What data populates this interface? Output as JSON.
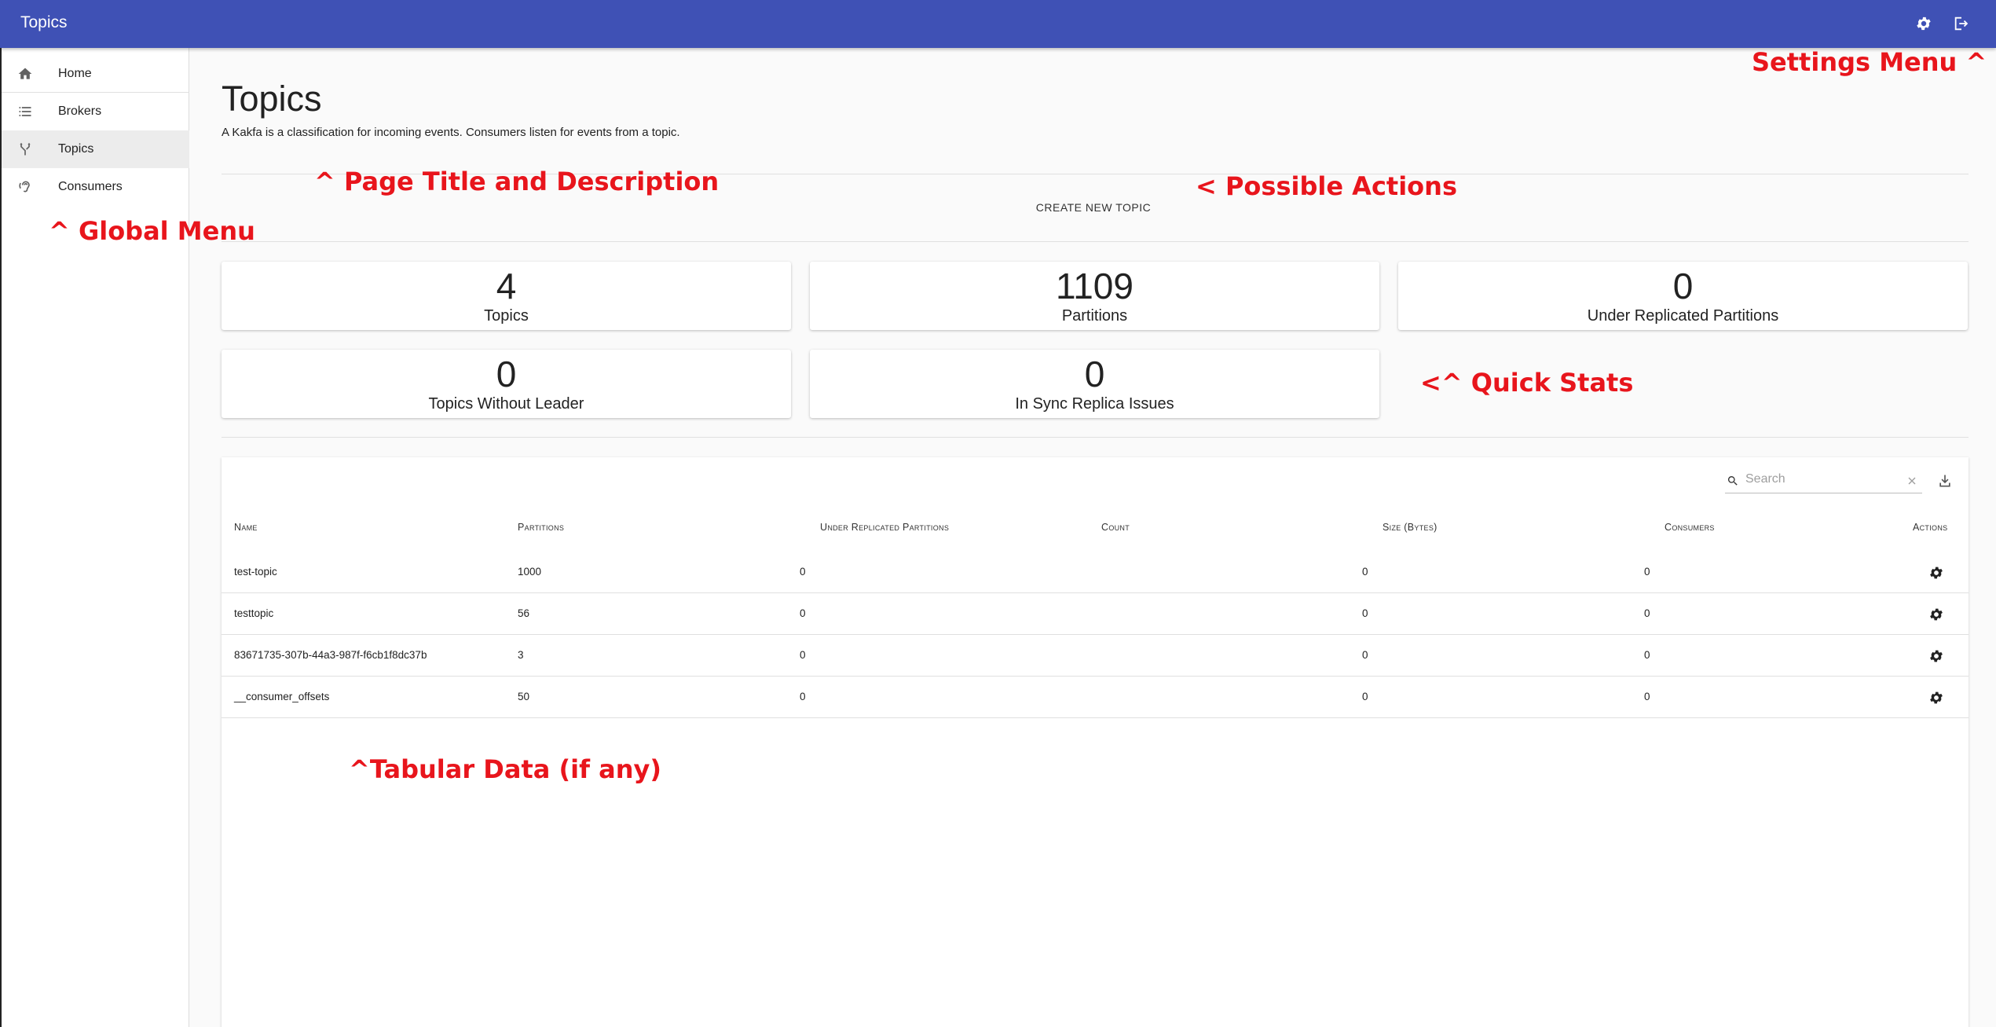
{
  "appbar": {
    "title": "Topics",
    "settings_icon": "gear-icon",
    "signout_icon": "exit-icon"
  },
  "sidebar": {
    "items": [
      {
        "label": "Home",
        "icon": "home-icon"
      },
      {
        "label": "Brokers",
        "icon": "list-icon"
      },
      {
        "label": "Topics",
        "icon": "fork-icon",
        "active": true
      },
      {
        "label": "Consumers",
        "icon": "ear-icon"
      }
    ]
  },
  "page": {
    "title": "Topics",
    "description": "A Kakfa is a classification for incoming events. Consumers listen for events from a topic.",
    "action_label": "CREATE NEW TOPIC"
  },
  "stats": [
    {
      "value": "4",
      "label": "Topics"
    },
    {
      "value": "1109",
      "label": "Partitions"
    },
    {
      "value": "0",
      "label": "Under Replicated Partitions"
    },
    {
      "value": "0",
      "label": "Topics Without Leader"
    },
    {
      "value": "0",
      "label": "In Sync Replica Issues"
    }
  ],
  "table": {
    "search_placeholder": "Search",
    "headers": [
      "Name",
      "Partitions",
      "Under Replicated Partitions",
      "Count",
      "Size (Bytes)",
      "Consumers",
      "Actions"
    ],
    "rows": [
      {
        "name": "test-topic",
        "partitions": "1000",
        "under_replicated": "0",
        "count": "",
        "size": "0",
        "consumers": "0"
      },
      {
        "name": "testtopic",
        "partitions": "56",
        "under_replicated": "0",
        "count": "",
        "size": "0",
        "consumers": "0"
      },
      {
        "name": "83671735-307b-44a3-987f-f6cb1f8dc37b",
        "partitions": "3",
        "under_replicated": "0",
        "count": "",
        "size": "0",
        "consumers": "0"
      },
      {
        "name": "__consumer_offsets",
        "partitions": "50",
        "under_replicated": "0",
        "count": "",
        "size": "0",
        "consumers": "0"
      }
    ]
  },
  "annotations": {
    "settings_menu": "Settings Menu ^",
    "page_title": "^ Page Title and Description",
    "actions": "< Possible Actions",
    "global_menu": "^ Global Menu",
    "quick_stats": "<^ Quick Stats",
    "tabular": "^Tabular Data (if any)"
  },
  "colors": {
    "appbar": "#3f51b5",
    "annotation": "#e8151c",
    "active_nav": "#ececec"
  }
}
